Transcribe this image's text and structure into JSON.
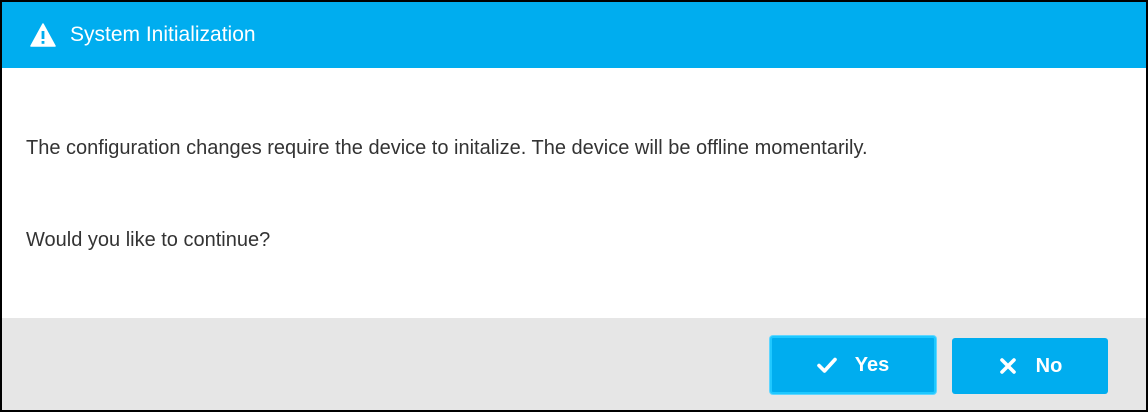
{
  "dialog": {
    "title": "System Initialization",
    "title_icon": "warning-icon",
    "message": "The configuration changes require the device to initalize. The device will be offline momentarily.",
    "question": "Would you like to continue?"
  },
  "buttons": {
    "yes_label": "Yes",
    "yes_icon": "checkmark-icon",
    "no_label": "No",
    "no_icon": "close-icon"
  },
  "colors": {
    "accent": "#00adef",
    "footer_bg": "#e6e6e6",
    "text": "#333333"
  }
}
